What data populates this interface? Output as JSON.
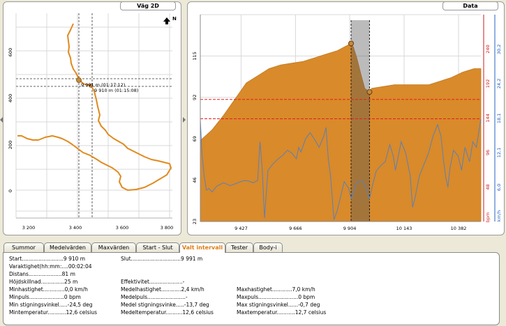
{
  "map_panel": {
    "title": "Väg 2D",
    "north_label": "N",
    "x_ticks": [
      "3 200",
      "3 400",
      "3 600",
      "3 800"
    ],
    "y_ticks": [
      "600",
      "400",
      "200",
      "0"
    ],
    "marker_labels": [
      "9 991 m (01:17:12)",
      "9 910 m (01:15:08)"
    ]
  },
  "chart_data": {
    "type": "area",
    "title": "Data",
    "x_tick_labels": [
      "9 427",
      "9 666",
      "9 904",
      "10 143",
      "10 382"
    ],
    "xlim": [
      9248,
      10480
    ],
    "altitude_ticks": [
      "23",
      "46",
      "69",
      "92",
      "115"
    ],
    "altitude_ylim": [
      23,
      138
    ],
    "bpm_ticks": [
      "48",
      "96",
      "144",
      "192",
      "240"
    ],
    "bpm_unit": "bpm",
    "speed_ticks": [
      "6,0",
      "12,1",
      "18,1",
      "24,2",
      "30,2"
    ],
    "speed_unit": "km/h",
    "selection": [
      9910,
      9991
    ],
    "altitude_points": [
      [
        9248,
        68
      ],
      [
        9300,
        74
      ],
      [
        9350,
        82
      ],
      [
        9400,
        91
      ],
      [
        9450,
        100
      ],
      [
        9500,
        104
      ],
      [
        9550,
        108
      ],
      [
        9600,
        110
      ],
      [
        9650,
        111
      ],
      [
        9700,
        112
      ],
      [
        9750,
        114
      ],
      [
        9800,
        116
      ],
      [
        9850,
        118
      ],
      [
        9880,
        120
      ],
      [
        9910,
        122
      ],
      [
        9920,
        120
      ],
      [
        9935,
        114
      ],
      [
        9955,
        104
      ],
      [
        9970,
        97
      ],
      [
        9991,
        95
      ],
      [
        10000,
        97
      ],
      [
        10050,
        98
      ],
      [
        10100,
        99
      ],
      [
        10150,
        99
      ],
      [
        10200,
        99
      ],
      [
        10250,
        99
      ],
      [
        10300,
        101
      ],
      [
        10350,
        103
      ],
      [
        10400,
        106
      ],
      [
        10450,
        108
      ],
      [
        10480,
        108
      ]
    ],
    "speed_points": [
      [
        9248,
        18
      ],
      [
        9255,
        12
      ],
      [
        9265,
        8
      ],
      [
        9275,
        5.5
      ],
      [
        9285,
        5.8
      ],
      [
        9300,
        5.2
      ],
      [
        9320,
        6.2
      ],
      [
        9350,
        6.8
      ],
      [
        9380,
        6.3
      ],
      [
        9400,
        6.6
      ],
      [
        9420,
        6.9
      ],
      [
        9440,
        7.2
      ],
      [
        9460,
        7.1
      ],
      [
        9480,
        6.8
      ],
      [
        9500,
        7.2
      ],
      [
        9510,
        14
      ],
      [
        9520,
        9
      ],
      [
        9530,
        0.6
      ],
      [
        9545,
        9
      ],
      [
        9565,
        10
      ],
      [
        9590,
        11
      ],
      [
        9610,
        11.6
      ],
      [
        9630,
        12.5
      ],
      [
        9650,
        12
      ],
      [
        9670,
        11
      ],
      [
        9680,
        13
      ],
      [
        9690,
        12.2
      ],
      [
        9710,
        14.5
      ],
      [
        9730,
        15.6
      ],
      [
        9750,
        14.4
      ],
      [
        9770,
        13
      ],
      [
        9790,
        15
      ],
      [
        9800,
        16.5
      ],
      [
        9810,
        11
      ],
      [
        9820,
        8
      ],
      [
        9835,
        0.3
      ],
      [
        9850,
        2
      ],
      [
        9880,
        7
      ],
      [
        9900,
        5.8
      ],
      [
        9910,
        4
      ],
      [
        9920,
        5
      ],
      [
        9930,
        6.5
      ],
      [
        9945,
        7
      ],
      [
        9960,
        7.2
      ],
      [
        9975,
        6
      ],
      [
        9991,
        4
      ],
      [
        10005,
        6.5
      ],
      [
        10020,
        8.8
      ],
      [
        10040,
        9.8
      ],
      [
        10060,
        10.5
      ],
      [
        10080,
        13.5
      ],
      [
        10095,
        11.5
      ],
      [
        10105,
        9
      ],
      [
        10115,
        11
      ],
      [
        10130,
        14
      ],
      [
        10150,
        12
      ],
      [
        10170,
        8
      ],
      [
        10180,
        2.5
      ],
      [
        10190,
        4
      ],
      [
        10210,
        8
      ],
      [
        10230,
        10
      ],
      [
        10250,
        12
      ],
      [
        10270,
        15
      ],
      [
        10290,
        17
      ],
      [
        10305,
        15
      ],
      [
        10315,
        11
      ],
      [
        10325,
        8
      ],
      [
        10335,
        6
      ],
      [
        10345,
        9.5
      ],
      [
        10360,
        12.5
      ],
      [
        10380,
        11.5
      ],
      [
        10395,
        9
      ],
      [
        10410,
        13
      ],
      [
        10430,
        10.5
      ],
      [
        10445,
        14
      ],
      [
        10460,
        13
      ],
      [
        10480,
        18
      ]
    ],
    "bpm_ref_lines": [
      170,
      143
    ]
  },
  "tabs": [
    "Summor",
    "Medelvärden",
    "Maxvärden",
    "Start - Slut",
    "Valt intervall",
    "Tester",
    "Body-i"
  ],
  "active_tab": "Valt intervall",
  "stats": [
    "Start.........................9 910 m",
    "Varaktighet(hh:mm:....00:02:04",
    "Distans....................81 m",
    "Höjdskillnad..............25 m",
    "Minhastighet.............0,0 km/h",
    "Minpuls.....................0 bpm",
    "Min stigningsvinkel.....-24,5 deg",
    "Mintemperatur...........12,6 celsius",
    "Slut..............................9 991 m",
    "Effektivitet....................-",
    "Medelhastighet............2,4 km/h",
    "Medelpuls.......................-",
    "Medel stigningsvinke.....-13,7 deg",
    "Medeltemperatur..........12,6 celsius",
    "Maxhastighet............7,0 km/h",
    "Maxpuls........................0 bpm",
    "Max stigningsvinkel......-0,7 deg",
    "Maxtemperatur...........12,7 celsius"
  ],
  "colors": {
    "fill": "#d98a2a",
    "speed_line": "#5b80b8",
    "ref_line": "#e02020",
    "bpm_axis": "#cc1a1a",
    "speed_axis": "#2060c0",
    "active_tab": "#e07b10"
  }
}
